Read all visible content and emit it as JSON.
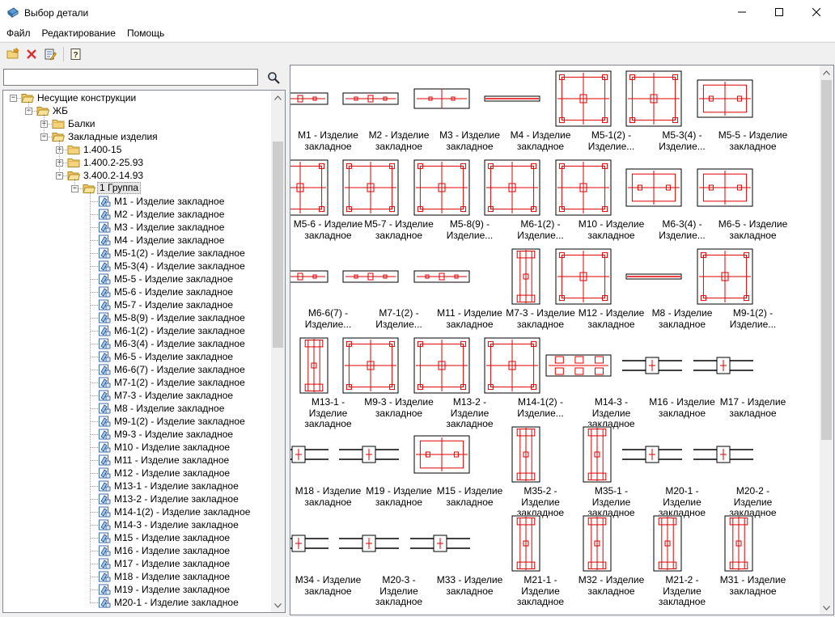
{
  "window": {
    "title": "Выбор детали"
  },
  "menu": [
    "Файл",
    "Редактирование",
    "Помощь"
  ],
  "toolbar": {
    "buttons": [
      {
        "name": "open-folder-icon"
      },
      {
        "name": "delete-icon",
        "color": "#d63131"
      },
      {
        "name": "edit-list-icon"
      },
      {
        "name": "help-icon"
      }
    ]
  },
  "search": {
    "value": "",
    "placeholder": ""
  },
  "tree": [
    {
      "label": "Несущие конструкции",
      "level": 0,
      "exp": "-",
      "icon": "folder-open"
    },
    {
      "label": "ЖБ",
      "level": 1,
      "exp": "-",
      "icon": "folder-open"
    },
    {
      "label": "Балки",
      "level": 2,
      "exp": "+",
      "icon": "folder"
    },
    {
      "label": "Закладные изделия",
      "level": 2,
      "exp": "-",
      "icon": "folder-open"
    },
    {
      "label": "1.400-15",
      "level": 3,
      "exp": "+",
      "icon": "folder"
    },
    {
      "label": "1.400.2-25.93",
      "level": 3,
      "exp": "+",
      "icon": "folder"
    },
    {
      "label": "3.400.2-14.93",
      "level": 3,
      "exp": "-",
      "icon": "folder-open"
    },
    {
      "label": "1 Группа",
      "level": 4,
      "exp": "-",
      "icon": "folder-open",
      "selected": true
    },
    {
      "label": "M1 - Изделие закладное",
      "level": 5,
      "icon": "part"
    },
    {
      "label": "M2 - Изделие закладное",
      "level": 5,
      "icon": "part"
    },
    {
      "label": "M3 - Изделие закладное",
      "level": 5,
      "icon": "part"
    },
    {
      "label": "M4 - Изделие закладное",
      "level": 5,
      "icon": "part"
    },
    {
      "label": "M5-1(2) - Изделие закладное",
      "level": 5,
      "icon": "part"
    },
    {
      "label": "M5-3(4) - Изделие закладное",
      "level": 5,
      "icon": "part"
    },
    {
      "label": "M5-5 - Изделие закладное",
      "level": 5,
      "icon": "part"
    },
    {
      "label": "M5-6 - Изделие закладное",
      "level": 5,
      "icon": "part"
    },
    {
      "label": "M5-7 - Изделие закладное",
      "level": 5,
      "icon": "part"
    },
    {
      "label": "M5-8(9) - Изделие закладное",
      "level": 5,
      "icon": "part"
    },
    {
      "label": "M6-1(2) - Изделие закладное",
      "level": 5,
      "icon": "part"
    },
    {
      "label": "M6-3(4) - Изделие закладное",
      "level": 5,
      "icon": "part"
    },
    {
      "label": "M6-5 - Изделие закладное",
      "level": 5,
      "icon": "part"
    },
    {
      "label": "M6-6(7) - Изделие закладное",
      "level": 5,
      "icon": "part"
    },
    {
      "label": "M7-1(2) - Изделие закладное",
      "level": 5,
      "icon": "part"
    },
    {
      "label": "M7-3 - Изделие закладное",
      "level": 5,
      "icon": "part"
    },
    {
      "label": "M8 - Изделие закладное",
      "level": 5,
      "icon": "part"
    },
    {
      "label": "M9-1(2) - Изделие закладное",
      "level": 5,
      "icon": "part"
    },
    {
      "label": "M9-3 - Изделие закладное",
      "level": 5,
      "icon": "part"
    },
    {
      "label": "M10 - Изделие закладное",
      "level": 5,
      "icon": "part"
    },
    {
      "label": "M11 - Изделие закладное",
      "level": 5,
      "icon": "part"
    },
    {
      "label": "M12 - Изделие закладное",
      "level": 5,
      "icon": "part"
    },
    {
      "label": "M13-1 - Изделие закладное",
      "level": 5,
      "icon": "part"
    },
    {
      "label": "M13-2 - Изделие закладное",
      "level": 5,
      "icon": "part"
    },
    {
      "label": "M14-1(2) - Изделие закладное",
      "level": 5,
      "icon": "part"
    },
    {
      "label": "M14-3 - Изделие закладное",
      "level": 5,
      "icon": "part"
    },
    {
      "label": "M15 - Изделие закладное",
      "level": 5,
      "icon": "part"
    },
    {
      "label": "M16 - Изделие закладное",
      "level": 5,
      "icon": "part"
    },
    {
      "label": "M17 - Изделие закладное",
      "level": 5,
      "icon": "part"
    },
    {
      "label": "M18 - Изделие закладное",
      "level": 5,
      "icon": "part"
    },
    {
      "label": "M19 - Изделие закладное",
      "level": 5,
      "icon": "part"
    },
    {
      "label": "M20-1 - Изделие закладное",
      "level": 5,
      "icon": "part"
    }
  ],
  "gallery": [
    {
      "caption": "M1 - Изделие закладное",
      "kind": "flat"
    },
    {
      "caption": "M2 - Изделие закладное",
      "kind": "flat"
    },
    {
      "caption": "M3 - Изделие закладное",
      "kind": "flat3"
    },
    {
      "caption": "M4 - Изделие закладное",
      "kind": "bar"
    },
    {
      "caption": "M5-1(2) - Изделие...",
      "kind": "plate"
    },
    {
      "caption": "M5-3(4) - Изделие...",
      "kind": "plate"
    },
    {
      "caption": "M5-5 - Изделие закладное",
      "kind": "plateW"
    },
    {
      "caption": "M5-6 - Изделие закладное",
      "kind": "plate"
    },
    {
      "caption": "M5-7 - Изделие закладное",
      "kind": "plate"
    },
    {
      "caption": "M5-8(9) - Изделие...",
      "kind": "plate"
    },
    {
      "caption": "M6-1(2) - Изделие...",
      "kind": "plate"
    },
    {
      "caption": "M10 - Изделие закладное",
      "kind": "plate"
    },
    {
      "caption": "M6-3(4) - Изделие...",
      "kind": "plateW"
    },
    {
      "caption": "M6-5 - Изделие закладное",
      "kind": "plateW"
    },
    {
      "caption": "M6-6(7) - Изделие...",
      "kind": "flat"
    },
    {
      "caption": "M7-1(2) - Изделие...",
      "kind": "flat"
    },
    {
      "caption": "M11 - Изделие закладное",
      "kind": "flat"
    },
    {
      "caption": "M7-3 - Изделие закладное",
      "kind": "tall"
    },
    {
      "caption": "M12 - Изделие закладное",
      "kind": "plate"
    },
    {
      "caption": "M8 - Изделие закладное",
      "kind": "bar"
    },
    {
      "caption": "M9-1(2) - Изделие...",
      "kind": "plate"
    },
    {
      "caption": "M13-1 - Изделие закладное",
      "kind": "tall"
    },
    {
      "caption": "M9-3 - Изделие закладное",
      "kind": "plate"
    },
    {
      "caption": "M13-2 - Изделие закладное",
      "kind": "plate"
    },
    {
      "caption": "M14-1(2) - Изделие...",
      "kind": "plate"
    },
    {
      "caption": "M14-3 - Изделие закладное",
      "kind": "flatW"
    },
    {
      "caption": "M16 - Изделие закладное",
      "kind": "rod"
    },
    {
      "caption": "M17 - Изделие закладное",
      "kind": "rod"
    },
    {
      "caption": "M18 - Изделие закладное",
      "kind": "rod"
    },
    {
      "caption": "M19 - Изделие закладное",
      "kind": "rod"
    },
    {
      "caption": "M15 - Изделие закладное",
      "kind": "plateW"
    },
    {
      "caption": "M35-2 - Изделие закладное",
      "kind": "tall"
    },
    {
      "caption": "M35-1 - Изделие закладное",
      "kind": "tall"
    },
    {
      "caption": "M20-1 - Изделие закладное",
      "kind": "rod"
    },
    {
      "caption": "M20-2 - Изделие закладное",
      "kind": "rod"
    },
    {
      "caption": "M34 - Изделие закладное",
      "kind": "rod"
    },
    {
      "caption": "M20-3 - Изделие закладное",
      "kind": "rod"
    },
    {
      "caption": "M33 - Изделие закладное",
      "kind": "rod"
    },
    {
      "caption": "M21-1 - Изделие закладное",
      "kind": "tall"
    },
    {
      "caption": "M32 - Изделие закладное",
      "kind": "tall"
    },
    {
      "caption": "M21-2 - Изделие закладное",
      "kind": "tall"
    },
    {
      "caption": "M31 - Изделие закладное",
      "kind": "tall"
    }
  ],
  "colors": {
    "drawing_red": "#e00000",
    "folder_yellow": "#f4d37a",
    "selection": "#e5e5e5"
  }
}
